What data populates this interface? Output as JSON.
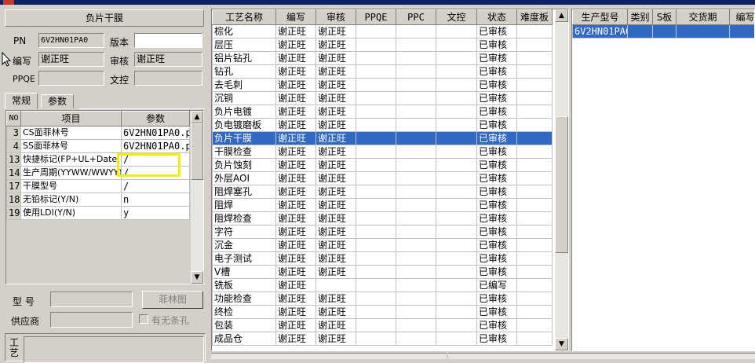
{
  "left": {
    "header_title": "负片干膜",
    "pn_label": "PN",
    "pn_value": "6V2HN01PA0",
    "version_label": "版本",
    "version_value": "",
    "author_label": "编写",
    "author_value": "谢正旺",
    "reviewer_label": "审核",
    "reviewer_value": "谢正旺",
    "ppqe_label": "PPQE",
    "ppqe_value": "",
    "doc_label": "文控",
    "doc_value": "",
    "tabs": [
      {
        "label": "常规"
      },
      {
        "label": "参数"
      }
    ],
    "param_headers": {
      "no": "NO",
      "item": "项目",
      "param": "参数"
    },
    "param_rows": [
      {
        "no": "3",
        "item": "CS面菲林号",
        "param": "6V2HN01PA0.plr"
      },
      {
        "no": "4",
        "item": "SS面菲林号",
        "param": "6V2HN01PA0.plr"
      },
      {
        "no": "13",
        "item": "快捷标记(FP+UL+Date",
        "param": "/"
      },
      {
        "no": "14",
        "item": "生产周期(YYWW/WWYY)",
        "param": "/"
      },
      {
        "no": "17",
        "item": "干膜型号",
        "param": "/"
      },
      {
        "no": "18",
        "item": "无铅标记(Y/N)",
        "param": "n"
      },
      {
        "no": "19",
        "item": "使用LDI(Y/N)",
        "param": "y"
      }
    ],
    "model_label": "型  号",
    "model_value": "",
    "film_button": "菲林图",
    "supplier_label": "供应商",
    "supplier_value": "",
    "no_strip_label": "有无条孔",
    "process_label": "工艺"
  },
  "process": {
    "headers": {
      "name": "工艺名称",
      "author": "编写",
      "reviewer": "审核",
      "ppqe": "PPQE",
      "ppc": "PPC",
      "doc": "文控",
      "status": "状态",
      "difficulty": "难度板"
    },
    "rows": [
      {
        "name": "棕化",
        "author": "谢正旺",
        "reviewer": "谢正旺",
        "status": "已审核"
      },
      {
        "name": "层压",
        "author": "谢正旺",
        "reviewer": "谢正旺",
        "status": "已审核"
      },
      {
        "name": "铝片钻孔",
        "author": "谢正旺",
        "reviewer": "谢正旺",
        "status": "已审核"
      },
      {
        "name": "钻孔",
        "author": "谢正旺",
        "reviewer": "谢正旺",
        "status": "已审核"
      },
      {
        "name": "去毛刺",
        "author": "谢正旺",
        "reviewer": "谢正旺",
        "status": "已审核"
      },
      {
        "name": "沉铜",
        "author": "谢正旺",
        "reviewer": "谢正旺",
        "status": "已审核"
      },
      {
        "name": "负片电镀",
        "author": "谢正旺",
        "reviewer": "谢正旺",
        "status": "已审核"
      },
      {
        "name": "负电镀磨板",
        "author": "谢正旺",
        "reviewer": "谢正旺",
        "status": "已审核"
      },
      {
        "name": "负片干膜",
        "author": "谢正旺",
        "reviewer": "谢正旺",
        "status": "已审核"
      },
      {
        "name": "干膜检查",
        "author": "谢正旺",
        "reviewer": "谢正旺",
        "status": "已审核"
      },
      {
        "name": "负片蚀刻",
        "author": "谢正旺",
        "reviewer": "谢正旺",
        "status": "已审核"
      },
      {
        "name": "外层AOI",
        "author": "谢正旺",
        "reviewer": "谢正旺",
        "status": "已审核"
      },
      {
        "name": "阻焊塞孔",
        "author": "谢正旺",
        "reviewer": "谢正旺",
        "status": "已审核"
      },
      {
        "name": "阻焊",
        "author": "谢正旺",
        "reviewer": "谢正旺",
        "status": "已审核"
      },
      {
        "name": "阻焊检查",
        "author": "谢正旺",
        "reviewer": "谢正旺",
        "status": "已审核"
      },
      {
        "name": "字符",
        "author": "谢正旺",
        "reviewer": "谢正旺",
        "status": "已审核"
      },
      {
        "name": "沉金",
        "author": "谢正旺",
        "reviewer": "谢正旺",
        "status": "已审核"
      },
      {
        "name": "电子测试",
        "author": "谢正旺",
        "reviewer": "谢正旺",
        "status": "已审核"
      },
      {
        "name": "V槽",
        "author": "谢正旺",
        "reviewer": "谢正旺",
        "status": "已审核"
      },
      {
        "name": "铣板",
        "author": "谢正旺",
        "reviewer": "",
        "status": "已编写"
      },
      {
        "name": "功能检查",
        "author": "谢正旺",
        "reviewer": "谢正旺",
        "status": "已审核"
      },
      {
        "name": "终检",
        "author": "谢正旺",
        "reviewer": "谢正旺",
        "status": "已审核"
      },
      {
        "name": "包装",
        "author": "谢正旺",
        "reviewer": "谢正旺",
        "status": "已审核"
      },
      {
        "name": "成品仓",
        "author": "谢正旺",
        "reviewer": "谢正旺",
        "status": "已审核"
      }
    ],
    "selected_index": 8
  },
  "products": {
    "headers": {
      "model": "生产型号",
      "category": "类别",
      "sboard": "S板",
      "delivery": "交货期",
      "number": "编写"
    },
    "rows": [
      {
        "model": "6V2HN01PA0",
        "category": "",
        "sboard": "",
        "delivery": "",
        "number": ""
      }
    ]
  },
  "colors": {
    "selection": "#316ac5",
    "highlight_box": "#f2f200"
  }
}
